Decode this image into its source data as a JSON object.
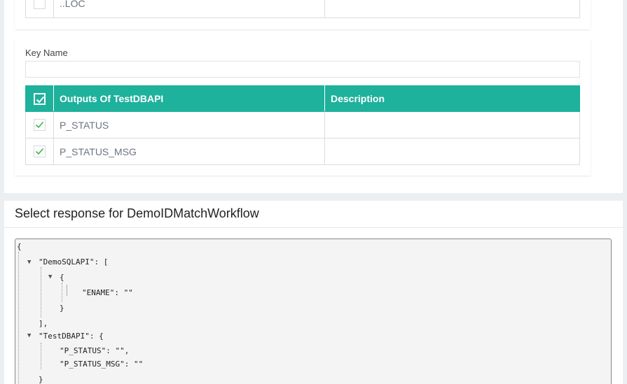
{
  "inputs_table": {
    "rows": [
      {
        "name": "..LOC",
        "description": "",
        "checked": false
      }
    ]
  },
  "key_name": {
    "label": "Key Name",
    "value": ""
  },
  "outputs_table": {
    "headers": {
      "name": "Outputs Of TestDBAPI",
      "description": "Description"
    },
    "header_checked": true,
    "rows": [
      {
        "name": "P_STATUS",
        "description": "",
        "checked": true
      },
      {
        "name": "P_STATUS_MSG",
        "description": "",
        "checked": true
      }
    ]
  },
  "response": {
    "title": "Select response for DemoIDMatchWorkflow",
    "json_lines": {
      "l1": "{",
      "l2": "\"DemoSQLAPI\": [",
      "l3": "{",
      "l4": "\"ENAME\": \"\"",
      "l5": "}",
      "l6": "],",
      "l7": "\"TestDBAPI\": {",
      "l8": "\"P_STATUS\": \"\",",
      "l9": "\"P_STATUS_MSG\": \"\"",
      "l10": "}"
    }
  },
  "colors": {
    "accent": "#1eb19b",
    "check": "#3cb54a"
  }
}
